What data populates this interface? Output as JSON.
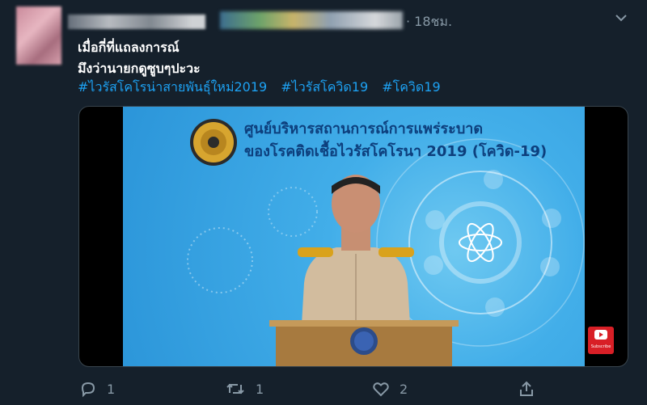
{
  "tweet": {
    "time": "· 18ชม.",
    "text_line1": "เมื่อกี่ที่แถลงการณ์",
    "text_line2": "มึงว่านายกดูซูบๆปะวะ",
    "hashtags": [
      "#ไวรัสโคโรน่าสายพันธุ์ใหม่2019",
      "#ไวรัสโควิด19",
      "#โควิด19"
    ]
  },
  "media": {
    "title_line1": "ศูนย์บริหารสถานการณ์การแพร่ระบาด",
    "title_line2": "ของโรคติดเชื้อไวรัสโคโรนา 2019 (โควิด-19)",
    "youtube_label": "Subscribe"
  },
  "actions": {
    "reply_count": "1",
    "retweet_count": "1",
    "like_count": "2"
  },
  "colors": {
    "background": "#15202b",
    "link": "#1da1f2",
    "muted": "#8899a6",
    "video_blue": "#42aee9"
  },
  "icons": [
    "chevron-down-icon",
    "reply-icon",
    "retweet-icon",
    "like-icon",
    "share-icon",
    "youtube-icon"
  ]
}
